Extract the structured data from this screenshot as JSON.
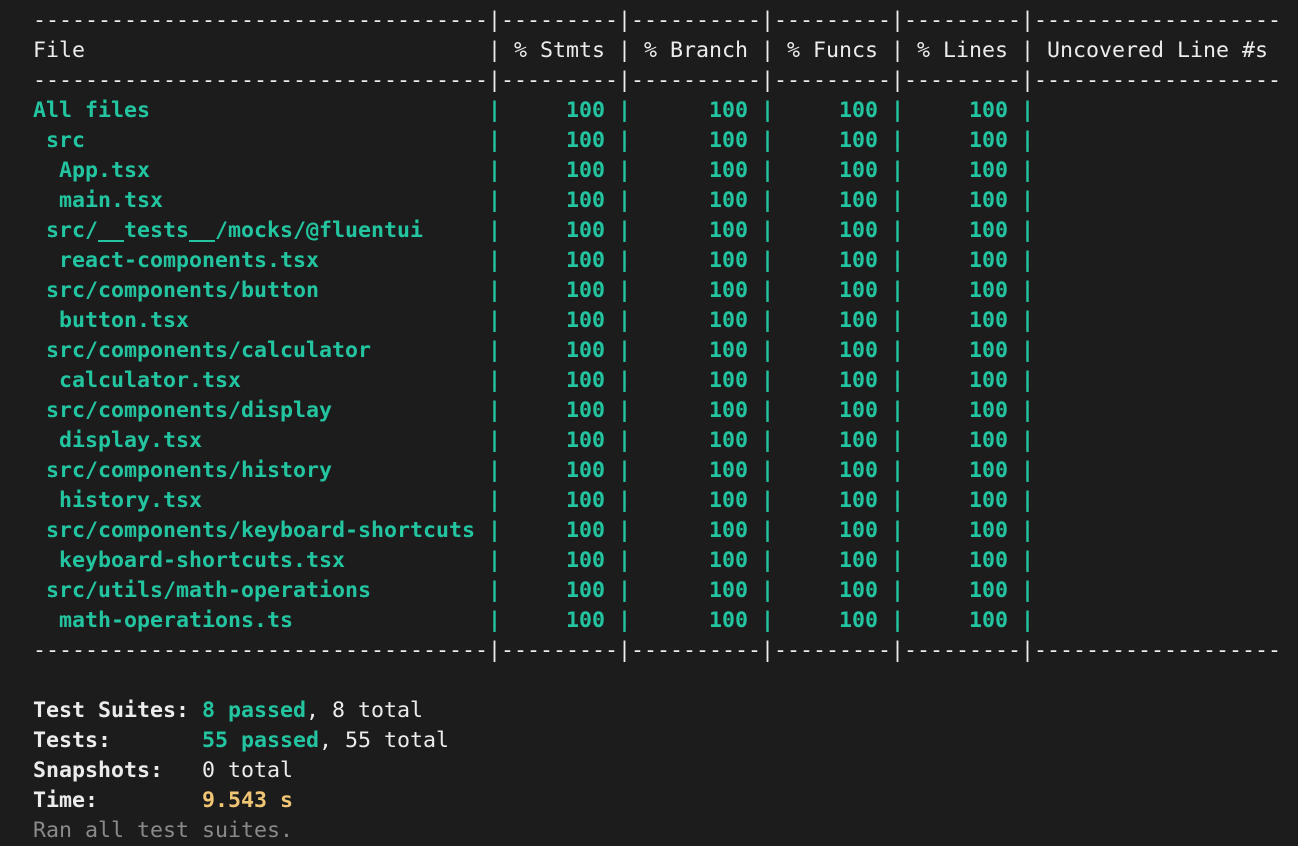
{
  "colors": {
    "background": "#1c1c1c",
    "text": "#cccccc",
    "coverage_green": "#23c4a0",
    "time_yellow": "#f0c674",
    "dim": "#8a8a8a"
  },
  "coverage": {
    "separator": "-----------------------------------|---------|----------|---------|---------|-------------------",
    "header": "File                               | % Stmts | % Branch | % Funcs | % Lines | Uncovered Line #s",
    "rows": [
      "All files                          |     100 |      100 |     100 |     100 |",
      " src                               |     100 |      100 |     100 |     100 |",
      "  App.tsx                          |     100 |      100 |     100 |     100 |",
      "  main.tsx                         |     100 |      100 |     100 |     100 |",
      " src/__tests__/mocks/@fluentui     |     100 |      100 |     100 |     100 |",
      "  react-components.tsx             |     100 |      100 |     100 |     100 |",
      " src/components/button             |     100 |      100 |     100 |     100 |",
      "  button.tsx                       |     100 |      100 |     100 |     100 |",
      " src/components/calculator         |     100 |      100 |     100 |     100 |",
      "  calculator.tsx                   |     100 |      100 |     100 |     100 |",
      " src/components/display            |     100 |      100 |     100 |     100 |",
      "  display.tsx                      |     100 |      100 |     100 |     100 |",
      " src/components/history            |     100 |      100 |     100 |     100 |",
      "  history.tsx                      |     100 |      100 |     100 |     100 |",
      " src/components/keyboard-shortcuts |     100 |      100 |     100 |     100 |",
      "  keyboard-shortcuts.tsx           |     100 |      100 |     100 |     100 |",
      " src/utils/math-operations         |     100 |      100 |     100 |     100 |",
      "  math-operations.ts               |     100 |      100 |     100 |     100 |"
    ]
  },
  "summary": {
    "suites_label": "Test Suites:",
    "suites_passed": "8 passed",
    "suites_total": ", 8 total",
    "tests_label": "Tests:",
    "tests_passed": "55 passed",
    "tests_total": ", 55 total",
    "snapshots_label": "Snapshots:",
    "snapshots_value": "0 total",
    "time_label": "Time:",
    "time_value": "9.543 s",
    "ran_all": "Ran all test suites."
  }
}
